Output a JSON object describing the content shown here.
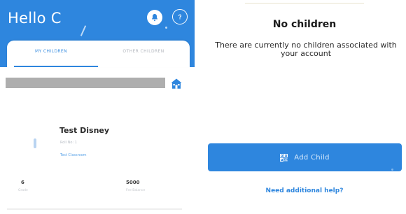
{
  "left": {
    "header": {
      "greeting": "Hello C",
      "bell_icon": "bell-icon",
      "help_icon": "help-circle-icon"
    },
    "tabs": [
      {
        "label": "MY CHILDREN",
        "active": true
      },
      {
        "label": "OTHER CHILDREN",
        "active": false
      }
    ],
    "school_icon": "school-icon",
    "child": {
      "name": "Test Disney",
      "subtitle": "Roll No: 1",
      "link": "Test Classroom"
    },
    "stats": [
      {
        "value": "6",
        "label": "Grade"
      },
      {
        "value": "5000",
        "label": "Fee Balance"
      }
    ]
  },
  "right": {
    "title": "No children",
    "subtitle": "There are currently no children associated with your account",
    "add_button": {
      "icon": "qr-code-icon",
      "label": "Add Child"
    },
    "help_link": "Need additional help?"
  },
  "colors": {
    "primary": "#2e86de",
    "header_bg": "#2e86de",
    "text_dark": "#1a1a1a"
  }
}
